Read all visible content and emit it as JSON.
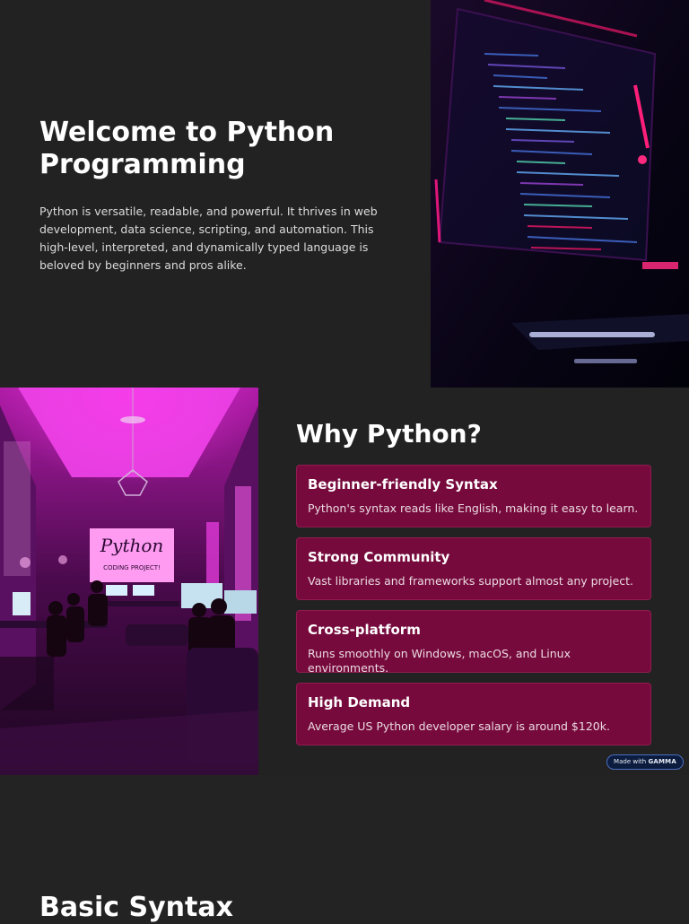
{
  "hero": {
    "title": "Welcome to Python Programming",
    "description": "Python is versatile, readable, and powerful. It thrives in web development, data science, scripting, and automation. This high-level, interpreted, and dynamically typed language is beloved by beginners and pros alike."
  },
  "why": {
    "title": "Why Python?",
    "image_sign_text": "Python",
    "image_sign_subtext": "CODING PROJECT!",
    "cards": [
      {
        "title": "Beginner-friendly Syntax",
        "desc": "Python's syntax reads like English, making it easy to learn."
      },
      {
        "title": "Strong Community",
        "desc": "Vast libraries and frameworks support almost any project."
      },
      {
        "title": "Cross-platform",
        "desc": "Runs smoothly on Windows, macOS, and Linux environments."
      },
      {
        "title": "High Demand",
        "desc": "Average US Python developer salary is around $120k."
      }
    ]
  },
  "badge": {
    "prefix": "Made with",
    "brand": "GAMMA"
  },
  "next_section": {
    "title": "Basic Syntax"
  },
  "colors": {
    "background": "#242323",
    "card": "#770a3c",
    "accent": "#e0167a",
    "badge": "#0c1c3f"
  }
}
